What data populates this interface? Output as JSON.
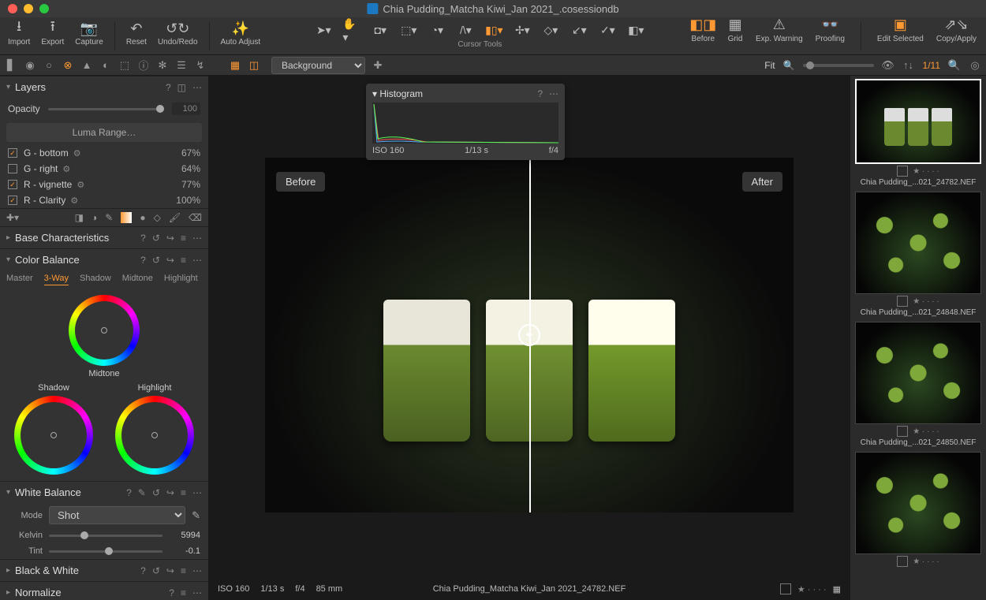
{
  "title": "Chia Pudding_Matcha Kiwi_Jan 2021_.cosessiondb",
  "toolbar": {
    "import": "Import",
    "export": "Export",
    "capture": "Capture",
    "reset": "Reset",
    "undo_redo": "Undo/Redo",
    "auto_adjust": "Auto Adjust",
    "cursor_tools": "Cursor Tools",
    "before": "Before",
    "grid": "Grid",
    "exp_warning": "Exp. Warning",
    "proofing": "Proofing",
    "edit_selected": "Edit Selected",
    "copy_apply": "Copy/Apply"
  },
  "viewer_bar": {
    "background": "Background",
    "fit": "Fit",
    "counter": "1/11"
  },
  "layers": {
    "title": "Layers",
    "opacity_label": "Opacity",
    "opacity_value": "100",
    "luma": "Luma Range…",
    "items": [
      {
        "checked": true,
        "name": "G - bottom",
        "pct": "67%"
      },
      {
        "checked": false,
        "name": "G - right",
        "pct": "64%"
      },
      {
        "checked": true,
        "name": "R - vignette",
        "pct": "77%"
      },
      {
        "checked": true,
        "name": "R - Clarity",
        "pct": "100%"
      }
    ]
  },
  "base_char": {
    "title": "Base Characteristics"
  },
  "color_balance": {
    "title": "Color Balance",
    "tabs": [
      "Master",
      "3-Way",
      "Shadow",
      "Midtone",
      "Highlight"
    ],
    "active_tab": "3-Way",
    "wheels": {
      "shadow": "Shadow",
      "midtone": "Midtone",
      "highlight": "Highlight"
    }
  },
  "white_balance": {
    "title": "White Balance",
    "mode_label": "Mode",
    "mode_value": "Shot",
    "kelvin_label": "Kelvin",
    "kelvin_value": "5994",
    "tint_label": "Tint",
    "tint_value": "-0.1"
  },
  "black_white": {
    "title": "Black & White"
  },
  "normalize": {
    "title": "Normalize"
  },
  "histogram": {
    "title": "Histogram",
    "iso": "ISO 160",
    "shutter": "1/13 s",
    "aperture": "f/4"
  },
  "viewer": {
    "before": "Before",
    "after": "After",
    "footer_iso": "ISO 160",
    "footer_shutter": "1/13 s",
    "footer_aperture": "f/4",
    "footer_focal": "85 mm",
    "filename": "Chia Pudding_Matcha Kiwi_Jan 2021_24782.NEF"
  },
  "browser": {
    "thumbs": [
      {
        "name": "Chia Pudding_...021_24782.NEF",
        "selected": true,
        "style": "glasses"
      },
      {
        "name": "Chia Pudding_...021_24848.NEF",
        "selected": false,
        "style": "pattern"
      },
      {
        "name": "Chia Pudding_...021_24850.NEF",
        "selected": false,
        "style": "pattern"
      },
      {
        "name": "",
        "selected": false,
        "style": "pattern"
      }
    ]
  }
}
